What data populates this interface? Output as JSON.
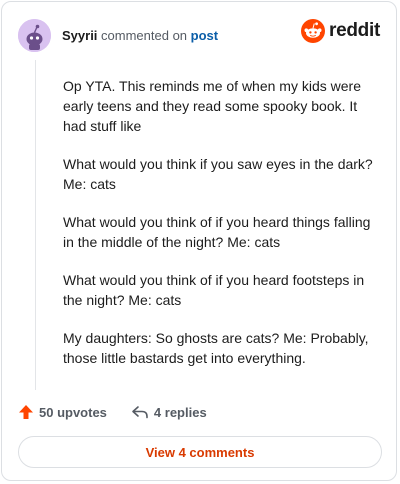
{
  "header": {
    "username": "Syyrii",
    "action_text": "commented on",
    "post_link": "post",
    "brand_name": "reddit"
  },
  "comment": {
    "paragraphs": [
      "Op YTA. This reminds me of when my kids were early teens and they read some spooky book. It had stuff like",
      "What would you think if you saw eyes in the dark? Me: cats",
      "What would you think of if you heard things falling in the middle of the night? Me: cats",
      "What would you think of if you heard footsteps in the night? Me: cats",
      "My daughters: So ghosts are cats? Me: Probably, those little bastards get into everything."
    ]
  },
  "actions": {
    "upvotes": "50 upvotes",
    "replies": "4 replies"
  },
  "footer": {
    "view_comments_label": "View 4 comments"
  },
  "colors": {
    "brand_orange": "#ff4500",
    "upvote_orange": "#ff4500",
    "link_blue": "#0b5ea8",
    "view_button_text": "#d93a00",
    "avatar_bg": "#d9c2f0"
  },
  "icons": {
    "avatar": "snoo-avatar-icon",
    "brand": "reddit-logo-icon",
    "upvote": "upvote-arrow-icon",
    "reply": "reply-arrow-icon"
  }
}
